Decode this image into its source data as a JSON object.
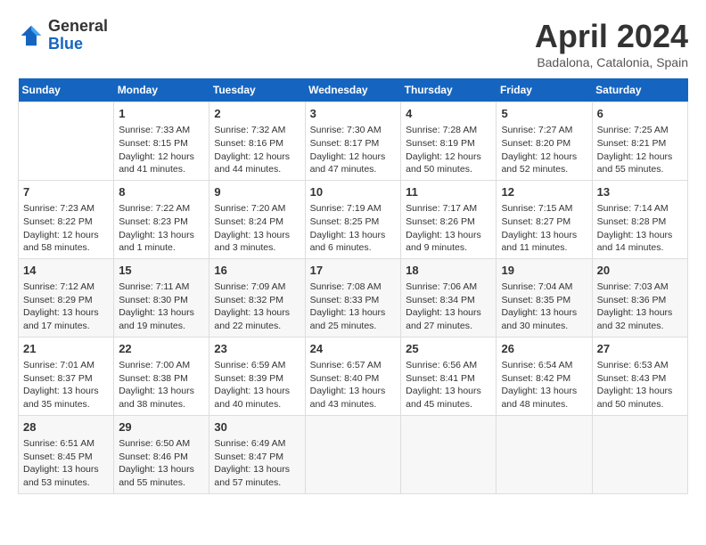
{
  "header": {
    "logo_general": "General",
    "logo_blue": "Blue",
    "month_title": "April 2024",
    "location": "Badalona, Catalonia, Spain"
  },
  "days_of_week": [
    "Sunday",
    "Monday",
    "Tuesday",
    "Wednesday",
    "Thursday",
    "Friday",
    "Saturday"
  ],
  "weeks": [
    [
      {
        "day": "",
        "info": ""
      },
      {
        "day": "1",
        "info": "Sunrise: 7:33 AM\nSunset: 8:15 PM\nDaylight: 12 hours\nand 41 minutes."
      },
      {
        "day": "2",
        "info": "Sunrise: 7:32 AM\nSunset: 8:16 PM\nDaylight: 12 hours\nand 44 minutes."
      },
      {
        "day": "3",
        "info": "Sunrise: 7:30 AM\nSunset: 8:17 PM\nDaylight: 12 hours\nand 47 minutes."
      },
      {
        "day": "4",
        "info": "Sunrise: 7:28 AM\nSunset: 8:19 PM\nDaylight: 12 hours\nand 50 minutes."
      },
      {
        "day": "5",
        "info": "Sunrise: 7:27 AM\nSunset: 8:20 PM\nDaylight: 12 hours\nand 52 minutes."
      },
      {
        "day": "6",
        "info": "Sunrise: 7:25 AM\nSunset: 8:21 PM\nDaylight: 12 hours\nand 55 minutes."
      }
    ],
    [
      {
        "day": "7",
        "info": "Sunrise: 7:23 AM\nSunset: 8:22 PM\nDaylight: 12 hours\nand 58 minutes."
      },
      {
        "day": "8",
        "info": "Sunrise: 7:22 AM\nSunset: 8:23 PM\nDaylight: 13 hours\nand 1 minute."
      },
      {
        "day": "9",
        "info": "Sunrise: 7:20 AM\nSunset: 8:24 PM\nDaylight: 13 hours\nand 3 minutes."
      },
      {
        "day": "10",
        "info": "Sunrise: 7:19 AM\nSunset: 8:25 PM\nDaylight: 13 hours\nand 6 minutes."
      },
      {
        "day": "11",
        "info": "Sunrise: 7:17 AM\nSunset: 8:26 PM\nDaylight: 13 hours\nand 9 minutes."
      },
      {
        "day": "12",
        "info": "Sunrise: 7:15 AM\nSunset: 8:27 PM\nDaylight: 13 hours\nand 11 minutes."
      },
      {
        "day": "13",
        "info": "Sunrise: 7:14 AM\nSunset: 8:28 PM\nDaylight: 13 hours\nand 14 minutes."
      }
    ],
    [
      {
        "day": "14",
        "info": "Sunrise: 7:12 AM\nSunset: 8:29 PM\nDaylight: 13 hours\nand 17 minutes."
      },
      {
        "day": "15",
        "info": "Sunrise: 7:11 AM\nSunset: 8:30 PM\nDaylight: 13 hours\nand 19 minutes."
      },
      {
        "day": "16",
        "info": "Sunrise: 7:09 AM\nSunset: 8:32 PM\nDaylight: 13 hours\nand 22 minutes."
      },
      {
        "day": "17",
        "info": "Sunrise: 7:08 AM\nSunset: 8:33 PM\nDaylight: 13 hours\nand 25 minutes."
      },
      {
        "day": "18",
        "info": "Sunrise: 7:06 AM\nSunset: 8:34 PM\nDaylight: 13 hours\nand 27 minutes."
      },
      {
        "day": "19",
        "info": "Sunrise: 7:04 AM\nSunset: 8:35 PM\nDaylight: 13 hours\nand 30 minutes."
      },
      {
        "day": "20",
        "info": "Sunrise: 7:03 AM\nSunset: 8:36 PM\nDaylight: 13 hours\nand 32 minutes."
      }
    ],
    [
      {
        "day": "21",
        "info": "Sunrise: 7:01 AM\nSunset: 8:37 PM\nDaylight: 13 hours\nand 35 minutes."
      },
      {
        "day": "22",
        "info": "Sunrise: 7:00 AM\nSunset: 8:38 PM\nDaylight: 13 hours\nand 38 minutes."
      },
      {
        "day": "23",
        "info": "Sunrise: 6:59 AM\nSunset: 8:39 PM\nDaylight: 13 hours\nand 40 minutes."
      },
      {
        "day": "24",
        "info": "Sunrise: 6:57 AM\nSunset: 8:40 PM\nDaylight: 13 hours\nand 43 minutes."
      },
      {
        "day": "25",
        "info": "Sunrise: 6:56 AM\nSunset: 8:41 PM\nDaylight: 13 hours\nand 45 minutes."
      },
      {
        "day": "26",
        "info": "Sunrise: 6:54 AM\nSunset: 8:42 PM\nDaylight: 13 hours\nand 48 minutes."
      },
      {
        "day": "27",
        "info": "Sunrise: 6:53 AM\nSunset: 8:43 PM\nDaylight: 13 hours\nand 50 minutes."
      }
    ],
    [
      {
        "day": "28",
        "info": "Sunrise: 6:51 AM\nSunset: 8:45 PM\nDaylight: 13 hours\nand 53 minutes."
      },
      {
        "day": "29",
        "info": "Sunrise: 6:50 AM\nSunset: 8:46 PM\nDaylight: 13 hours\nand 55 minutes."
      },
      {
        "day": "30",
        "info": "Sunrise: 6:49 AM\nSunset: 8:47 PM\nDaylight: 13 hours\nand 57 minutes."
      },
      {
        "day": "",
        "info": ""
      },
      {
        "day": "",
        "info": ""
      },
      {
        "day": "",
        "info": ""
      },
      {
        "day": "",
        "info": ""
      }
    ]
  ]
}
